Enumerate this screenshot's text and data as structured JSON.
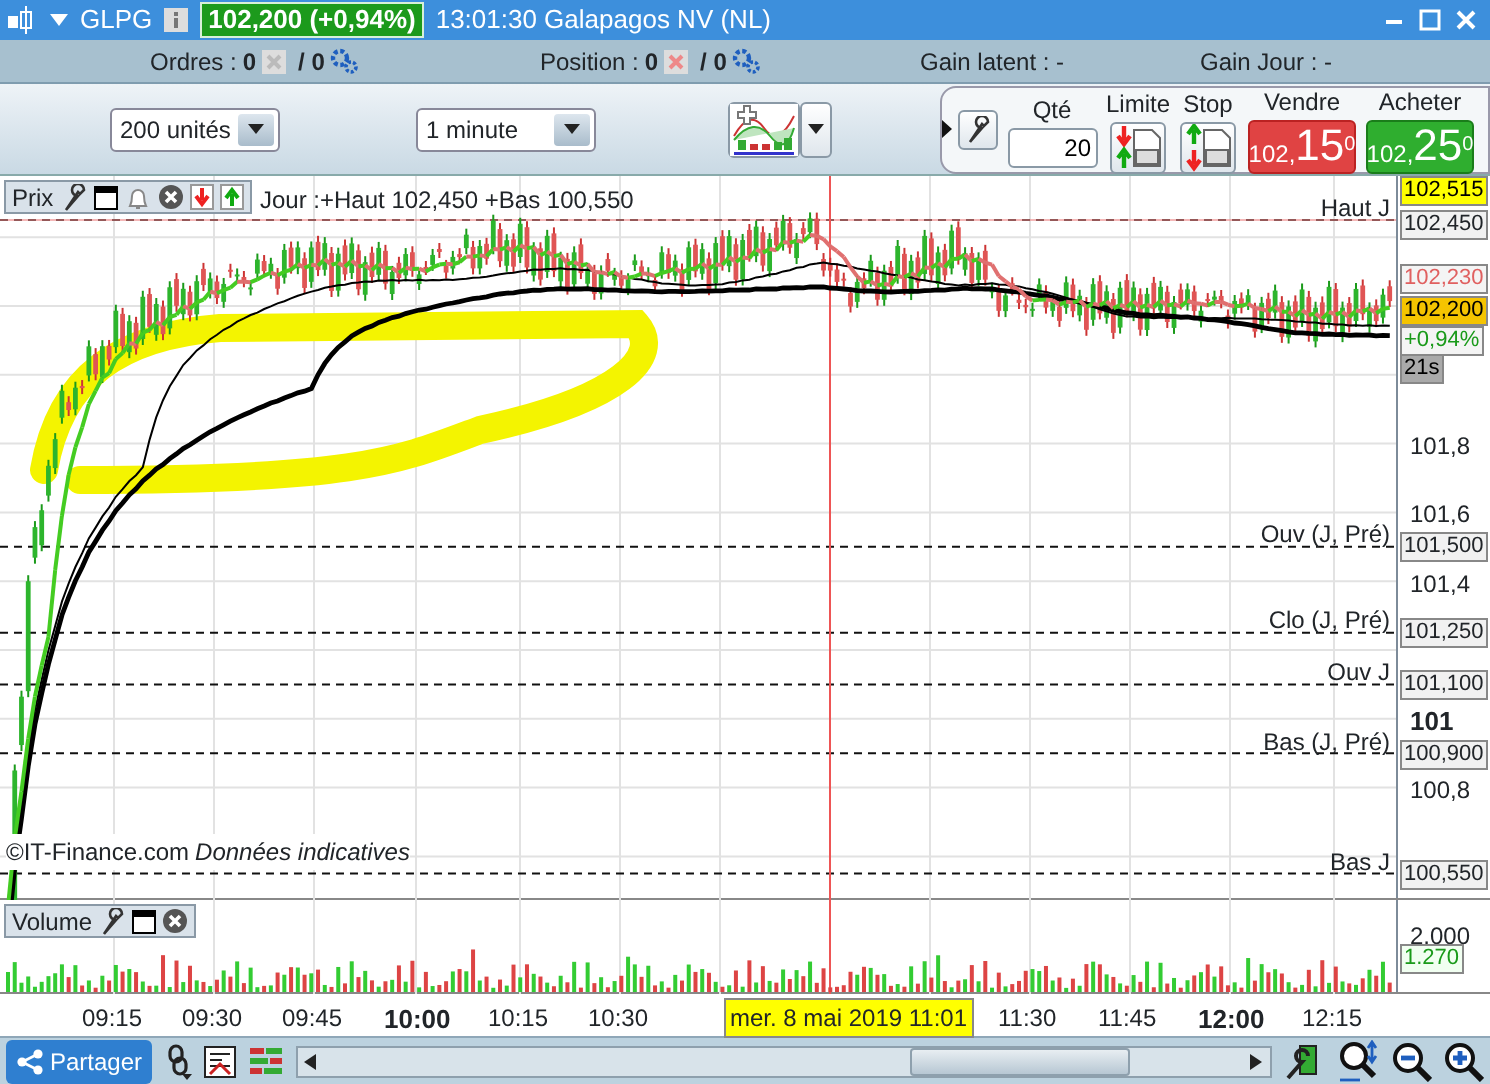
{
  "header": {
    "symbol": "GLPG",
    "quote": "102,200 (+0,94%)",
    "title": "13:01:30 Galapagos NV (NL)"
  },
  "account_bar": [
    {
      "kind": "counter",
      "label": "Ordres :",
      "count": "0",
      "total": "/ 0"
    },
    {
      "kind": "counter",
      "label": "Position :",
      "count": "0",
      "total": "/ 0"
    },
    {
      "kind": "text",
      "label": "Gain latent : -"
    },
    {
      "kind": "text",
      "label": "Gain Jour : -"
    }
  ],
  "toolbar": {
    "quantity_select": "200 unités",
    "period_select": "1 minute",
    "qty_label": "Qté",
    "qty_value": "20",
    "limit_label": "Limite",
    "stop_label": "Stop",
    "sell": {
      "label": "Vendre",
      "price_int": "102,",
      "price_big": "15",
      "price_sup": "0"
    },
    "buy": {
      "label": "Acheter",
      "price_int": "102,",
      "price_big": "25",
      "price_sup": "0"
    }
  },
  "price_panel": {
    "title": "Prix",
    "day_info": "Jour :+Haut 102,450 +Bas 100,550",
    "levels": [
      {
        "label": "Haut J",
        "value": "102,450"
      },
      {
        "label": "Ouv (J, Pré)",
        "value": "101,500"
      },
      {
        "label": "Clo (J, Pré)",
        "value": "101,250"
      },
      {
        "label": "Ouv J",
        "value": "101,100"
      },
      {
        "label": "Bas (J, Pré)",
        "value": "100,900"
      },
      {
        "label": "Bas J",
        "value": "100,550"
      }
    ],
    "axis_ticks": [
      {
        "label": "101,8",
        "bold": false
      },
      {
        "label": "101,6",
        "bold": false
      },
      {
        "label": "101,4",
        "bold": false
      },
      {
        "label": "101",
        "bold": true
      },
      {
        "label": "100,8",
        "bold": false
      }
    ],
    "tags": [
      {
        "kind": "high",
        "text": "102,515"
      },
      {
        "kind": "prev",
        "text": "102,230"
      },
      {
        "kind": "last",
        "text": "102,200"
      },
      {
        "kind": "change",
        "text": "+0,94%"
      },
      {
        "kind": "timer",
        "text": "21s"
      }
    ],
    "credit": "©IT-Finance.com",
    "disclaimer": "Données indicatives"
  },
  "volume_panel": {
    "title": "Volume",
    "axis_tick": "2.000",
    "last_tag": "1.270"
  },
  "time_axis": {
    "ticks": [
      {
        "label": "09:15",
        "bold": false
      },
      {
        "label": "09:30",
        "bold": false
      },
      {
        "label": "09:45",
        "bold": false
      },
      {
        "label": "10:00",
        "bold": true
      },
      {
        "label": "10:15",
        "bold": false
      },
      {
        "label": "10:30",
        "bold": false
      },
      {
        "label": "11:30",
        "bold": false
      },
      {
        "label": "11:45",
        "bold": false
      },
      {
        "label": "12:00",
        "bold": true
      },
      {
        "label": "12:15",
        "bold": false
      }
    ],
    "cursor_label": "mer. 8 mai 2019 11:01"
  },
  "footer": {
    "share_button": "Partager"
  }
}
